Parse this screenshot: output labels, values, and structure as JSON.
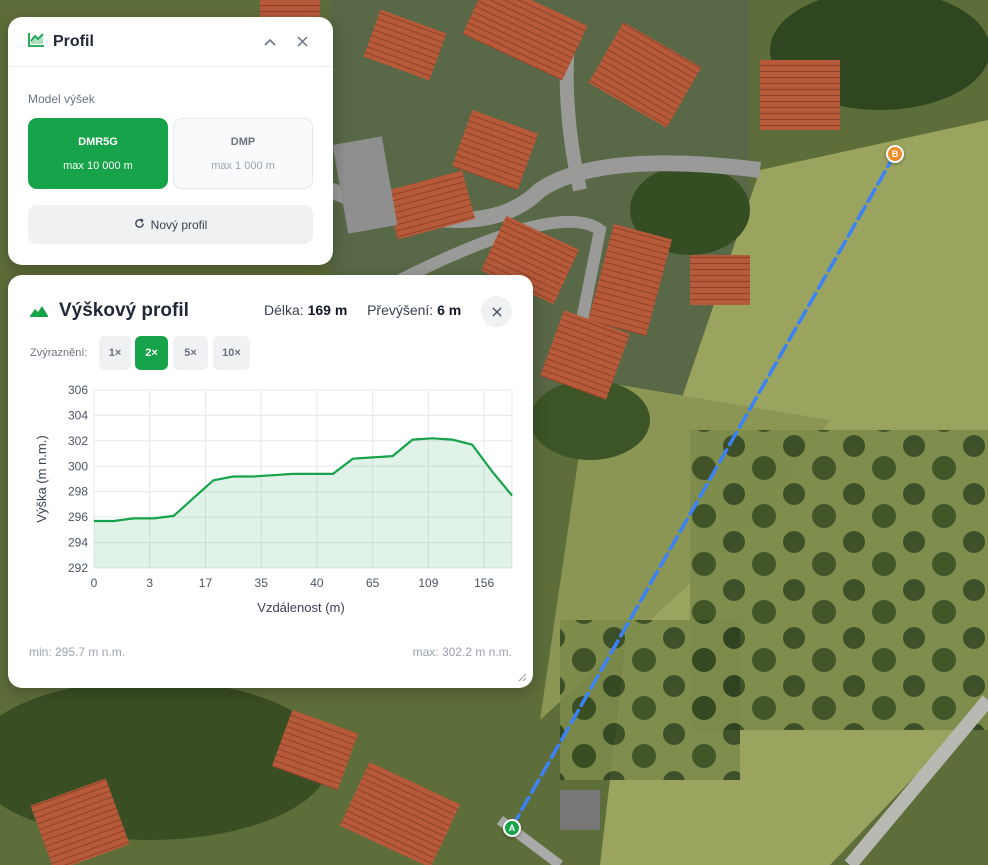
{
  "profile_panel": {
    "title": "Profil",
    "model_label": "Model výšek",
    "models": [
      {
        "name": "DMR5G",
        "sub": "max 10 000 m",
        "active": true
      },
      {
        "name": "DMP",
        "sub": "max 1 000 m",
        "active": false
      }
    ],
    "new_profile_label": "Nový profil"
  },
  "elevation_panel": {
    "title": "Výškový profil",
    "length_label": "Délka:",
    "length_value": "169 m",
    "gain_label": "Převýšení:",
    "gain_value": "6 m",
    "exaggeration_label": "Zvýraznění:",
    "exaggeration_options": [
      "1×",
      "2×",
      "5×",
      "10×"
    ],
    "exaggeration_active": "2×",
    "min_text": "min: 295.7 m n.m.",
    "max_text": "max: 302.2 m n.m."
  },
  "markers": {
    "start": "A",
    "end": "B"
  },
  "colors": {
    "accent": "#16a34a",
    "route": "#3b82f6",
    "end_marker": "#f28c28"
  },
  "chart_data": {
    "type": "area",
    "xlabel": "Vzdálenost (m)",
    "ylabel": "Výška (m n.m.)",
    "ylim": [
      292,
      306
    ],
    "yticks": [
      292,
      294,
      296,
      298,
      300,
      302,
      304,
      306
    ],
    "categories": [
      "0",
      "3",
      "17",
      "35",
      "40",
      "65",
      "109",
      "156"
    ],
    "series": [
      {
        "values": [
          295.7,
          295.7,
          295.9,
          295.9,
          296.1,
          297.5,
          298.9,
          299.2,
          299.2,
          299.3,
          299.4,
          299.4,
          299.4,
          300.6,
          300.7,
          300.8,
          302.1,
          302.2,
          302.1,
          301.7,
          299.6,
          297.7
        ]
      }
    ],
    "grid": true
  }
}
